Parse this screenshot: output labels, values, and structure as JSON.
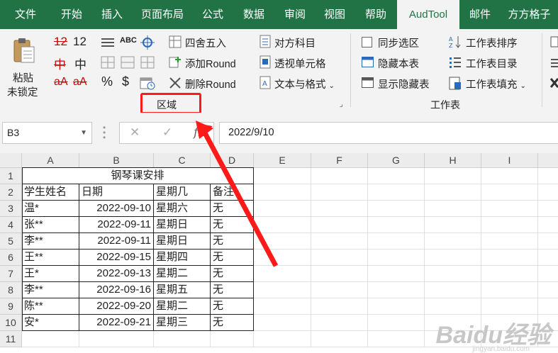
{
  "tabs": [
    {
      "label": "文件",
      "active": false
    },
    {
      "label": "开始",
      "active": false
    },
    {
      "label": "插入",
      "active": false
    },
    {
      "label": "页面布局",
      "active": false
    },
    {
      "label": "公式",
      "active": false
    },
    {
      "label": "数据",
      "active": false
    },
    {
      "label": "审阅",
      "active": false
    },
    {
      "label": "视图",
      "active": false
    },
    {
      "label": "帮助",
      "active": false
    },
    {
      "label": "AudTool",
      "active": true
    },
    {
      "label": "邮件",
      "active": false
    },
    {
      "label": "方方格子",
      "active": false
    }
  ],
  "ribbon": {
    "paste_label_1": "粘贴",
    "paste_label_2": "未锁定",
    "chars": {
      "num_a": "12",
      "num_b": "12",
      "ch_a": "中",
      "ch_b": "中",
      "mix_a": "aA",
      "mix_b": "aA",
      "abc": "ABC",
      "percent": "%",
      "dollar": "$"
    },
    "round_four": "四舍五入",
    "add_round": "添加Round",
    "del_round": "删除Round",
    "range_group": "区域",
    "align_subject": "对方科目",
    "perspective_cell": "透视单元格",
    "text_format": "文本与格式",
    "sync_select": "同步选区",
    "hide_sheet": "隐藏本表",
    "show_hidden": "显示隐藏表",
    "sheet_sort": "工作表排序",
    "sheet_toc": "工作表目录",
    "sheet_fill": "工作表填充",
    "sheet_group": "工作表"
  },
  "formula_bar": {
    "name_box": "B3",
    "formula": "2022/9/10",
    "fx": "fx",
    "cancel": "✕",
    "confirm": "✓"
  },
  "columns": [
    "A",
    "B",
    "C",
    "D",
    "E",
    "F",
    "G",
    "H",
    "I"
  ],
  "rows": [
    "1",
    "2",
    "3",
    "4",
    "5",
    "6",
    "7",
    "8",
    "9",
    "10",
    "11"
  ],
  "sheet": {
    "title": "钢琴课安排",
    "headers": [
      "学生姓名",
      "日期",
      "星期几",
      "备注"
    ],
    "records": [
      [
        "温*",
        "2022-09-10",
        "星期六",
        "无"
      ],
      [
        "张**",
        "2022-09-11",
        "星期日",
        "无"
      ],
      [
        "李**",
        "2022-09-11",
        "星期日",
        "无"
      ],
      [
        "王**",
        "2022-09-15",
        "星期四",
        "无"
      ],
      [
        "王*",
        "2022-09-13",
        "星期二",
        "无"
      ],
      [
        "李**",
        "2022-09-16",
        "星期五",
        "无"
      ],
      [
        "陈**",
        "2022-09-20",
        "星期二",
        "无"
      ],
      [
        "安*",
        "2022-09-21",
        "星期三",
        "无"
      ]
    ]
  },
  "watermark": "Baidu经验",
  "watermark_url": "jingyan.baidu.com",
  "colors": {
    "excel_green": "#217346",
    "highlight_red": "#ff1a1a"
  }
}
